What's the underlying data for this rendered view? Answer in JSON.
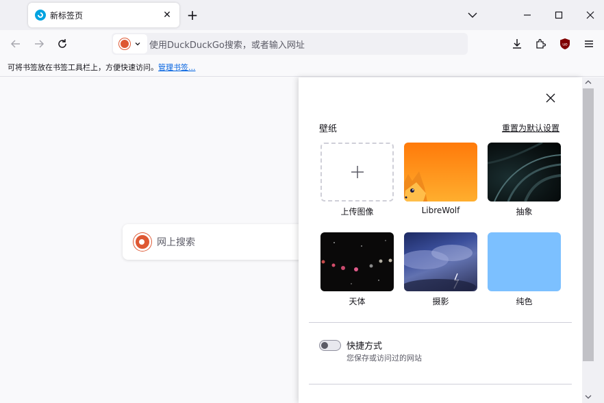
{
  "tab": {
    "title": "新标签页",
    "close": "✕"
  },
  "toolbar": {
    "new_tab": "+"
  },
  "urlbar": {
    "placeholder": "使用DuckDuckGo搜索，或者输入网址"
  },
  "bookmarks_bar": {
    "text": "可将书签放在书签工具栏上，方便快速访问。",
    "link": "管理书签..."
  },
  "page": {
    "search_placeholder": "网上搜索"
  },
  "customize": {
    "wallpaper_heading": "壁纸",
    "reset_label": "重置为默认设置",
    "tiles": [
      {
        "label": "上传图像",
        "icon": "plus-icon"
      },
      {
        "label": "LibreWolf"
      },
      {
        "label": "抽象"
      },
      {
        "label": "天体"
      },
      {
        "label": "摄影"
      },
      {
        "label": "纯色"
      }
    ],
    "shortcuts_title": "快捷方式",
    "shortcuts_desc": "您保存或访问过的网站",
    "shortcuts_enabled": false
  },
  "colors": {
    "accent": "#0061e0",
    "ddg": "#de5833",
    "ublock": "#800000",
    "solid_wallpaper": "#7cc0ff"
  }
}
